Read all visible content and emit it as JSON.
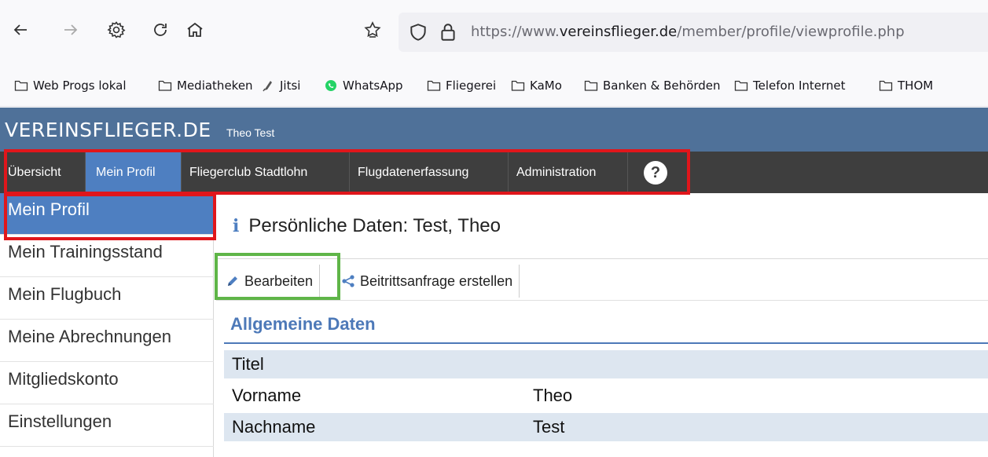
{
  "browser": {
    "url_prefix": "https://www.",
    "url_domain": "vereinsflieger.de",
    "url_path": "/member/profile/viewprofile.php",
    "bookmarks": [
      "Web Progs lokal",
      "Mediatheken",
      "Jitsi",
      "WhatsApp",
      "Fliegerei",
      "KaMo",
      "Banken & Behörden",
      "Telefon Internet",
      "THOM"
    ]
  },
  "header": {
    "site_title": "VEREINSFLIEGER.DE",
    "user_name": "Theo Test"
  },
  "topmenu": {
    "items": [
      "Übersicht",
      "Mein Profil",
      "Fliegerclub Stadtlohn",
      "Flugdatenerfassung",
      "Administration"
    ],
    "active": "Mein Profil",
    "help": "?"
  },
  "sidebar": {
    "items": [
      "Mein Profil",
      "Mein Trainingsstand",
      "Mein Flugbuch",
      "Meine Abrechnungen",
      "Mitgliedskonto",
      "Einstellungen"
    ]
  },
  "main": {
    "title": "Persönliche Daten: Test, Theo",
    "actions": {
      "edit": "Bearbeiten",
      "share": "Beitrittsanfrage erstellen"
    },
    "section_title": "Allgemeine Daten",
    "rows": [
      {
        "label": "Titel",
        "value": ""
      },
      {
        "label": "Vorname",
        "value": "Theo"
      },
      {
        "label": "Nachname",
        "value": "Test"
      }
    ]
  },
  "colors": {
    "header_bg": "#4f7199",
    "menu_bg": "#3e3e3e",
    "accent": "#4e7fc1",
    "highlight_red": "#e0161b",
    "highlight_green": "#5fb548"
  }
}
